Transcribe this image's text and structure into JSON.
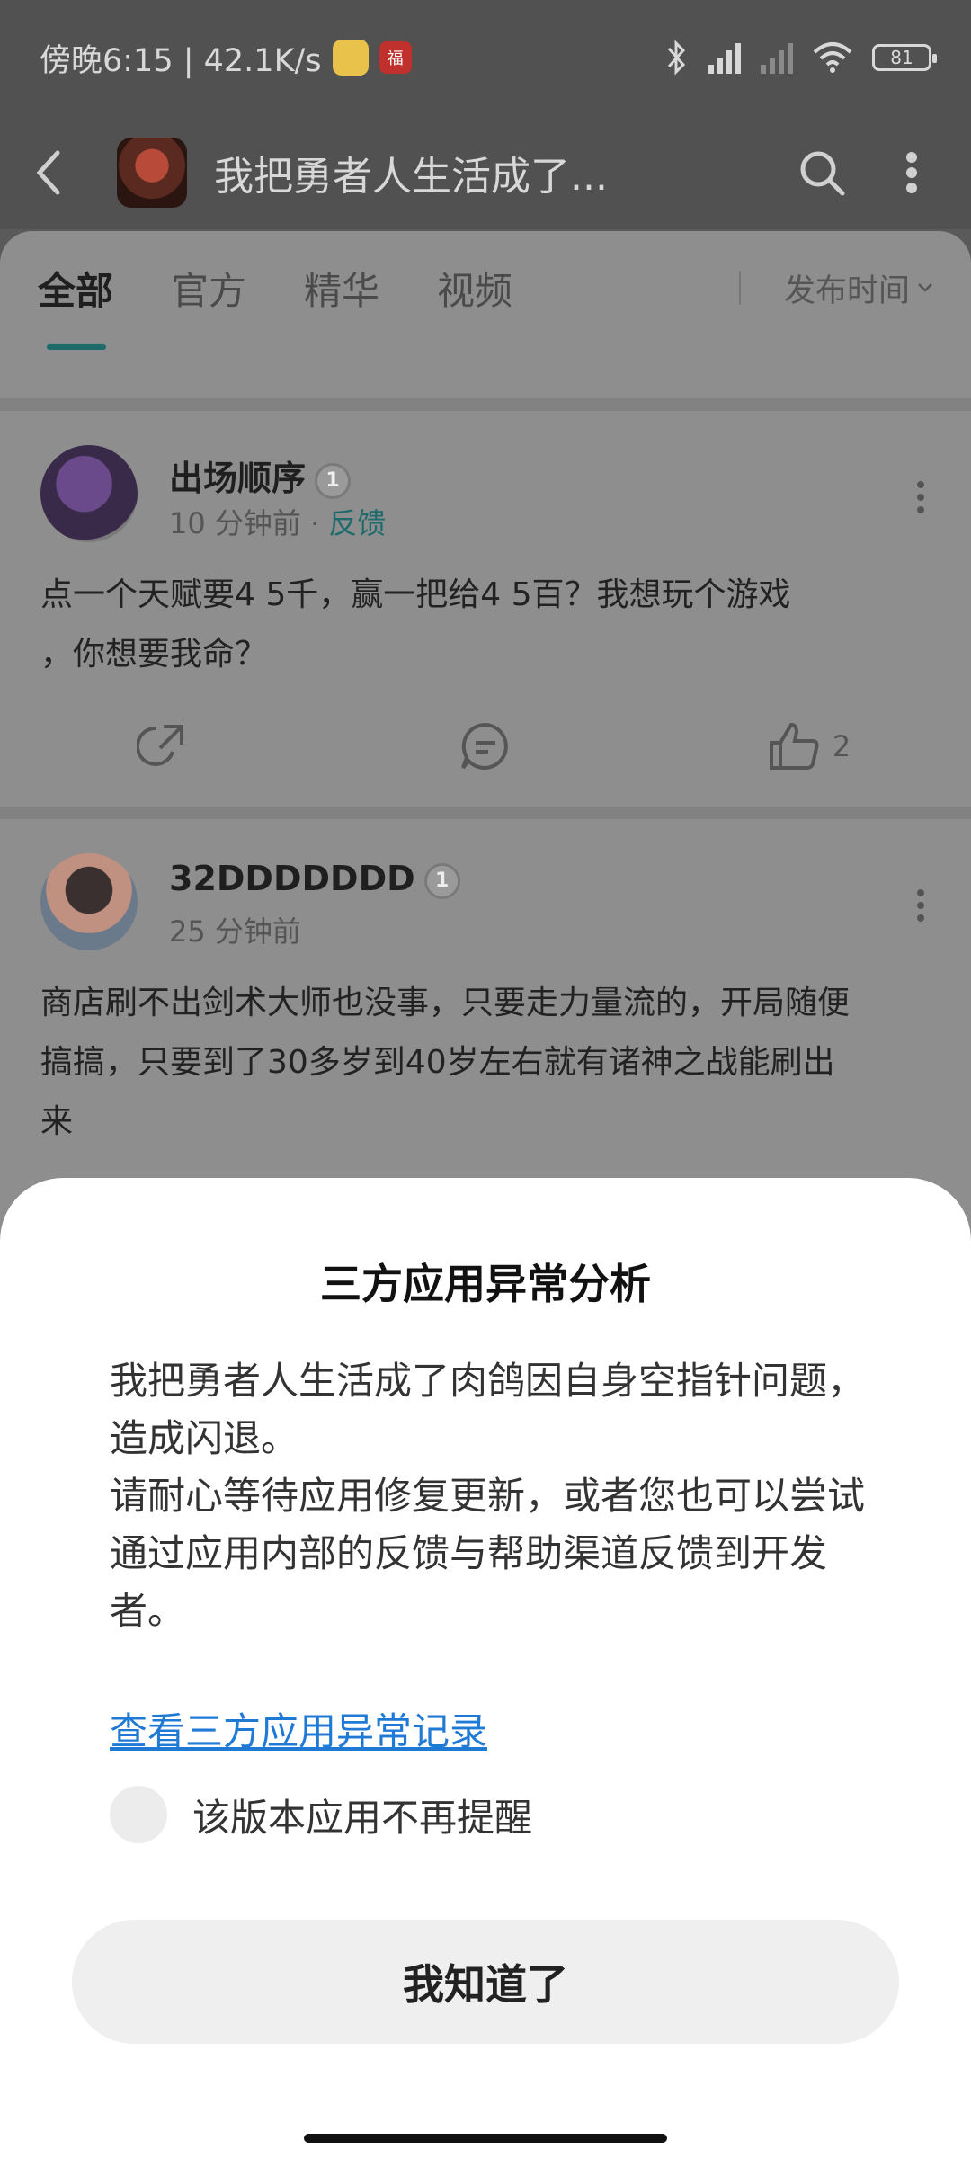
{
  "status_bar": {
    "time": "傍晚6:15 | 42.1K/s",
    "badge_text": "福",
    "battery": "81"
  },
  "header": {
    "title": "我把勇者人生活成了..."
  },
  "tabs": [
    {
      "label": "全部",
      "active": true
    },
    {
      "label": "官方",
      "active": false
    },
    {
      "label": "精华",
      "active": false
    },
    {
      "label": "视频",
      "active": false
    }
  ],
  "sort_label": "发布时间",
  "posts": [
    {
      "author": "出场顺序",
      "time": "10 分钟前",
      "tag": "反馈",
      "level": "1",
      "body_line1": "点一个天赋要4 5千，赢一把给4 5百？我想玩个游戏",
      "body_line2": "，你想要我命？",
      "like_count": "2"
    },
    {
      "author": "32DDDDDDD",
      "time": "25 分钟前",
      "level": "1",
      "body_line1": "商店刷不出剑术大师也没事，只要走力量流的，开局随便",
      "body_line2": "搞搞，只要到了30多岁到40岁左右就有诸神之战能刷出",
      "body_line3": "来"
    }
  ],
  "dialog": {
    "title": "三方应用异常分析",
    "message_1": "我把勇者人生活成了肉鸽因自身空指针问题，造成闪退。",
    "message_2": "请耐心等待应用修复更新，或者您也可以尝试通过应用内部的反馈与帮助渠道反馈到开发者。",
    "link": "查看三方应用异常记录",
    "checkbox_label": "该版本应用不再提醒",
    "button": "我知道了"
  }
}
